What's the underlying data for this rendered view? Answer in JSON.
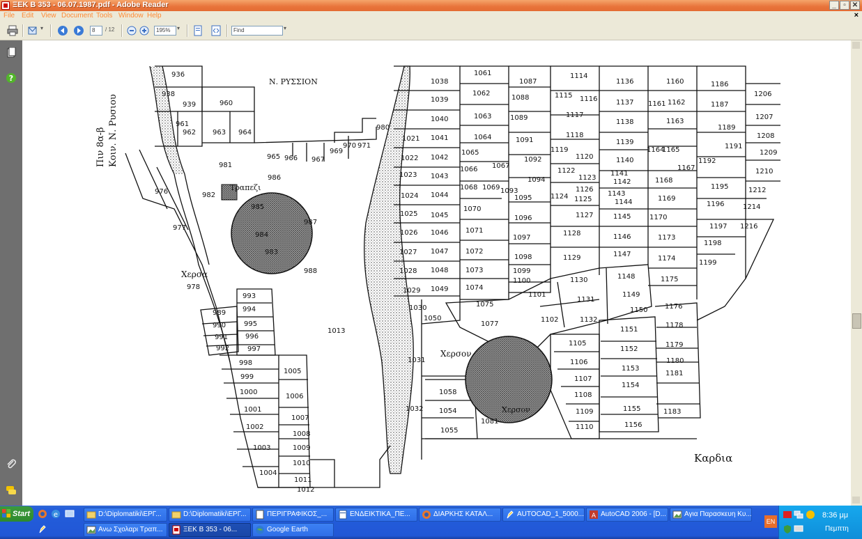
{
  "window": {
    "title": "ΞΕΚ Β 353 - 06.07.1987.pdf - Adobe Reader"
  },
  "menu": {
    "items": [
      "File",
      "Edit",
      "View",
      "Document",
      "Tools",
      "Window",
      "Help"
    ],
    "doc_close": "×"
  },
  "toolbar": {
    "page_current": "8",
    "page_total": "/ 12",
    "zoom": "195%",
    "find_placeholder": "Find"
  },
  "map": {
    "road_label": "Ν. ΡΥΣΣΙΟΝ",
    "vertical_label_1": "Πιν 8α-β",
    "vertical_label_2": "Κοιν. Ν. Ρυσιου",
    "label_trapezi": "Τραπεζι",
    "label_xerso_1": "Χερσα",
    "label_xerso_2": "Χερσον",
    "label_xerso_3": "Χερσον",
    "label_kardia": "Καρδια",
    "parcels_left_top": [
      "936",
      "938",
      "939",
      "960",
      "961",
      "962",
      "963",
      "964",
      "965",
      "966",
      "967",
      "968",
      "969",
      "970",
      "971",
      "980"
    ],
    "parcels_left_mid": [
      "981",
      "982",
      "986",
      "985",
      "987",
      "984",
      "988",
      "976",
      "977",
      "978"
    ],
    "parcels_left_col": [
      "993",
      "994",
      "995",
      "996",
      "997",
      "989",
      "990",
      "991",
      "992",
      "998",
      "999",
      "1000",
      "1001",
      "1002",
      "1003",
      "1004",
      "1005",
      "1006",
      "1007",
      "1008",
      "1009",
      "1010",
      "1011",
      "1012",
      "1013"
    ],
    "parcels_mid_col": [
      "1038",
      "1039",
      "1040",
      "1041",
      "1042",
      "1043",
      "1044",
      "1045",
      "1046",
      "1047",
      "1048",
      "1049",
      "1050",
      "1021",
      "1022",
      "1023",
      "1024",
      "1025",
      "1026",
      "1027",
      "1028",
      "1029",
      "1030",
      "1031",
      "1032",
      "1058",
      "1054",
      "1055"
    ],
    "parcels_center": [
      "1061",
      "1062",
      "1063",
      "1064",
      "1065",
      "1066",
      "1067",
      "1068",
      "1069",
      "1070",
      "1071",
      "1072",
      "1073",
      "1074",
      "1075",
      "1077",
      "1081",
      "1087",
      "1088",
      "1089",
      "1091",
      "1092",
      "1093",
      "1094",
      "1095",
      "1096",
      "1097",
      "1098",
      "1099",
      "1100",
      "1101",
      "1102",
      "1105",
      "1106",
      "1107",
      "1108",
      "1109",
      "1110"
    ],
    "parcels_right": [
      "1114",
      "1115",
      "1116",
      "1117",
      "1118",
      "1119",
      "1120",
      "1122",
      "1123",
      "1124",
      "1125",
      "1126",
      "1127",
      "1128",
      "1129",
      "1130",
      "1131",
      "1132",
      "1136",
      "1137",
      "1138",
      "1139",
      "1140",
      "1141",
      "1142",
      "1143",
      "1144",
      "1145",
      "1146",
      "1147",
      "1148",
      "1149",
      "1150",
      "1151",
      "1152",
      "1153",
      "1154",
      "1155",
      "1156",
      "1160",
      "1161",
      "1162",
      "1163",
      "1164",
      "1165",
      "1167",
      "1168",
      "1169",
      "1170",
      "1173",
      "1174",
      "1175",
      "1176",
      "1178",
      "1179",
      "1180",
      "1181",
      "1186",
      "1187",
      "1189",
      "1191",
      "1192",
      "1195",
      "1196",
      "1197",
      "1198",
      "1199",
      "1206",
      "1207",
      "1208",
      "1209",
      "1210",
      "1212",
      "1214",
      "1216"
    ]
  },
  "taskbar": {
    "start": "Start",
    "tasks": [
      "D:\\Diplomatiki\\ΕΡΓ...",
      "D:\\Diplomatiki\\ΕΡΓ...",
      "ΠΕΡΙΓΡΑΦΙΚΟΣ_...",
      "ΕΝΔΕΙΚΤΙΚΑ_ΠΕ...",
      "ΔΙΑΡΚΗΣ ΚΑΤΑΛ...",
      "AUTOCAD_1_5000...",
      "AutoCAD 2006 - [D...",
      "Αγια Παρασκευη Κυ...",
      "Ανω Σχολαρι Τραπ...",
      "ΞΕΚ Β 353 - 06...",
      "Google Earth"
    ],
    "lang": "EN",
    "clock": "8:36 μμ",
    "day": "Πεμπτη"
  },
  "colors": {
    "titlebar": "#e46c33",
    "taskbar": "#245edb",
    "tray": "#0f8ed9",
    "leftnav": "#6f6f6f"
  }
}
